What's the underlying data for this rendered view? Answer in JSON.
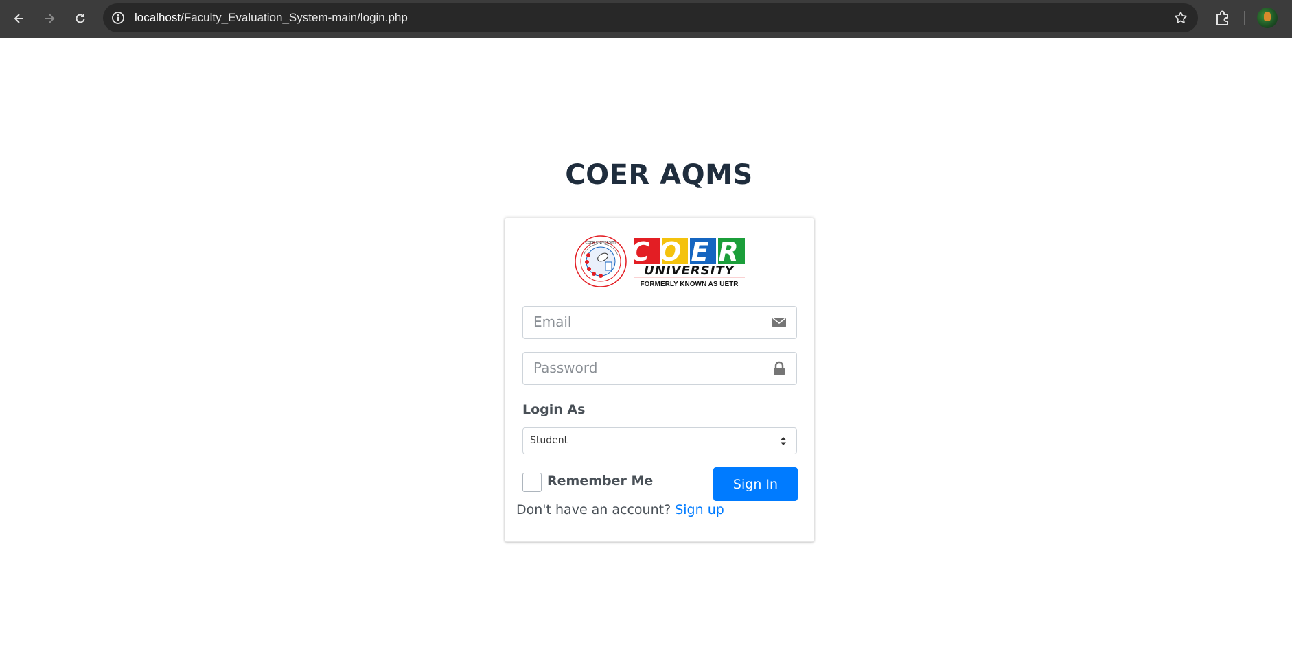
{
  "browser": {
    "url_host": "localhost",
    "url_path": "/Faculty_Evaluation_System-main/login.php"
  },
  "page": {
    "title": "COER AQMS"
  },
  "logo": {
    "seal_text_top": "COER UNIVERSITY",
    "wordmark": "COER",
    "subword": "UNIVERSITY",
    "tagline": "FORMERLY KNOWN AS UETR",
    "colors": [
      "#e31e24",
      "#f4c20d",
      "#1565c0",
      "#1b9e3a"
    ]
  },
  "form": {
    "email_placeholder": "Email",
    "password_placeholder": "Password",
    "login_as_label": "Login As",
    "role_selected": "Student",
    "remember_label": "Remember Me",
    "signin_label": "Sign In",
    "signup_prompt": "Don't have an account?",
    "signup_link": "Sign up"
  },
  "colors": {
    "primary": "#007bff",
    "title": "#1f2d3d"
  }
}
